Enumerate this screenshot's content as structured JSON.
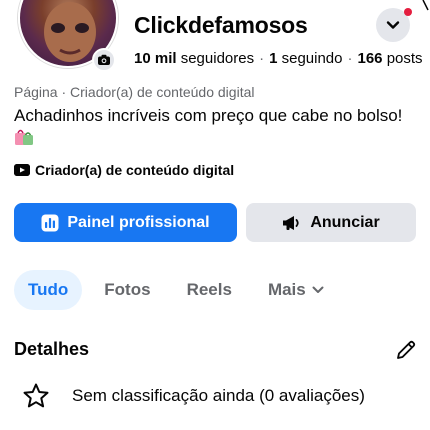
{
  "profile": {
    "name": "Clickdefamosos",
    "stats": {
      "followers_count": "10 mil",
      "followers_label": "seguidores",
      "following_count": "1",
      "following_label": "seguindo",
      "posts_count": "166",
      "posts_label": "posts",
      "separator": "·"
    },
    "category": "Página · Criador(a) de conteúdo digital",
    "bio": "Achadinhos incríveis com preço que cabe no bolso!",
    "bio_emoji_icon": "shopping-bags-icon",
    "creator_label": "Criador(a) de conteúdo digital"
  },
  "buttons": {
    "primary_label": "Painel profissional",
    "secondary_label": "Anunciar"
  },
  "tabs": {
    "items": [
      "Tudo",
      "Fotos",
      "Reels",
      "Mais"
    ],
    "active": "Tudo"
  },
  "details": {
    "title": "Detalhes",
    "rating_text": "Sem classificação ainda (0 avaliações)"
  },
  "colors": {
    "accent": "#1877f2",
    "tab_active_bg": "#e7f3ff",
    "button_secondary_bg": "#e4e6eb",
    "notification_dot": "#e41e3f",
    "muted_text": "#65676b"
  }
}
